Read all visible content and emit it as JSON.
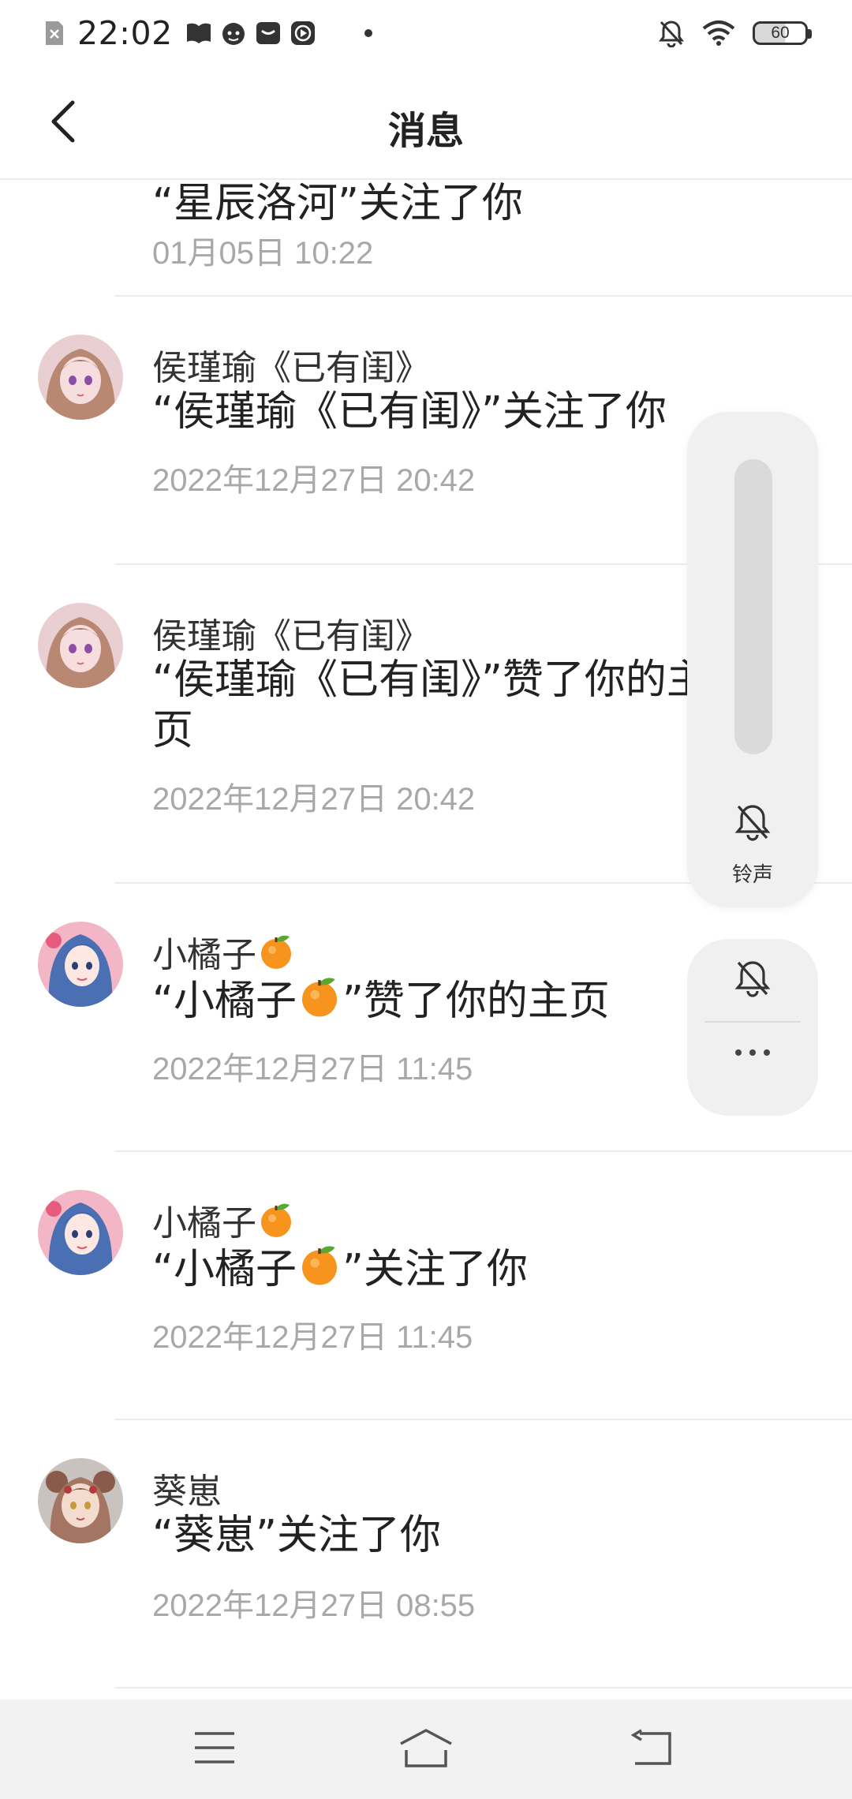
{
  "status_bar": {
    "time": "22:02",
    "battery": "60",
    "icons": [
      "sim-error-icon",
      "book-icon",
      "face-icon",
      "inbox-icon",
      "play-icon",
      "dot-icon",
      "bell-off-icon",
      "wifi-icon",
      "battery-icon"
    ]
  },
  "header": {
    "title": "消息",
    "back_icon": "chevron-left-icon"
  },
  "messages": [
    {
      "sender": "",
      "content": "“星辰洛河”关注了你",
      "time": "01月05日 10:22"
    },
    {
      "sender": "侯瑾瑜《已有闺》",
      "content": "“侯瑾瑜《已有闺》”关注了你",
      "time": "2022年12月27日 20:42"
    },
    {
      "sender": "侯瑾瑜《已有闺》",
      "content": "“侯瑾瑜《已有闺》”赞了你的主页",
      "time": "2022年12月27日 20:42"
    },
    {
      "sender": "小橘子",
      "content_prefix": "“小橘子",
      "content_suffix": "”赞了你的主页",
      "time": "2022年12月27日 11:45"
    },
    {
      "sender": "小橘子",
      "content_prefix": "“小橘子",
      "content_suffix": "”关注了你",
      "time": "2022年12月27日 11:45"
    },
    {
      "sender": "葵崽",
      "content": "“葵崽”关注了你",
      "time": "2022年12月27日 08:55"
    }
  ],
  "volume_panel": {
    "level": 0,
    "label": "铃声",
    "icon": "bell-off-icon"
  },
  "mini_panel": {
    "icon": "bell-off-icon",
    "more_icon": "more-dots-icon"
  },
  "nav_bar": {
    "icons": [
      "menu-icon",
      "home-icon",
      "back-icon"
    ]
  },
  "colors": {
    "time_text": "#a8a8a8",
    "divider": "#ececec",
    "panel_bg": "#f0f0f0",
    "nav_bg": "#f2f2f2"
  }
}
